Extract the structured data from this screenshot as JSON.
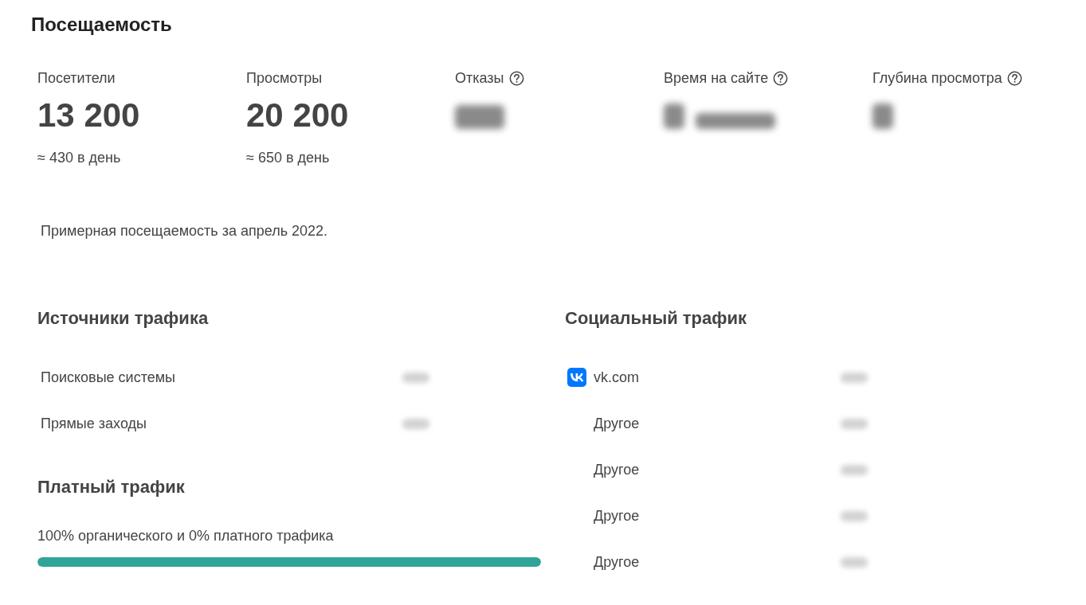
{
  "title": "Посещаемость",
  "metrics": [
    {
      "label": "Посетители",
      "help": false,
      "blurred": false,
      "value": "13 200",
      "per_day": "≈ 430 в день"
    },
    {
      "label": "Просмотры",
      "help": false,
      "blurred": false,
      "value": "20 200",
      "per_day": "≈ 650 в день"
    },
    {
      "label": "Отказы",
      "help": true,
      "blurred": true
    },
    {
      "label": "Время на сайте",
      "help": true,
      "blurred": true
    },
    {
      "label": "Глубина просмотра",
      "help": true,
      "blurred": true
    }
  ],
  "note": "Примерная посещаемость за апрель 2022.",
  "traffic_sources": {
    "title": "Источники трафика",
    "rows": [
      {
        "label": "Поисковые системы",
        "blurred": true
      },
      {
        "label": "Прямые заходы",
        "blurred": true
      }
    ]
  },
  "paid_traffic": {
    "title": "Платный трафик",
    "caption": "100% органического и 0% платного трафика",
    "level": 1
  },
  "social_traffic": {
    "title": "Социальный трафик",
    "rows": [
      {
        "label": "vk.com",
        "icon": true,
        "blurred": true
      },
      {
        "label": "Другое",
        "icon": false,
        "blurred": true
      },
      {
        "label": "Другое",
        "icon": false,
        "blurred": true
      },
      {
        "label": "Другое",
        "icon": false,
        "blurred": true
      },
      {
        "label": "Другое",
        "icon": false,
        "blurred": true
      }
    ]
  }
}
